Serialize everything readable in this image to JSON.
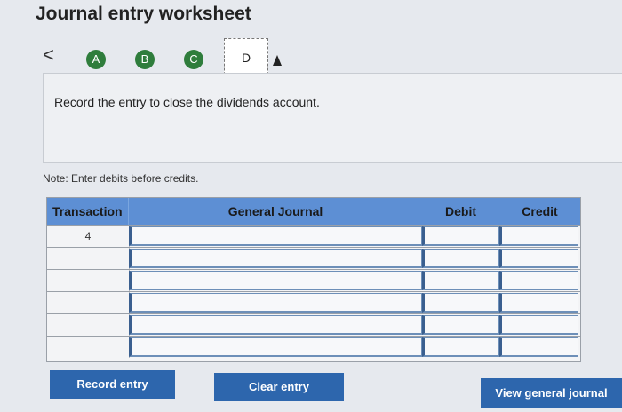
{
  "title": "Journal entry worksheet",
  "nav": {
    "back_symbol": "<",
    "steps": [
      "A",
      "B",
      "C",
      "D"
    ],
    "current_step": "D"
  },
  "instruction": "Record the entry to close the dividends account.",
  "note": "Note: Enter debits before credits.",
  "table": {
    "headers": {
      "transaction": "Transaction",
      "general_journal": "General Journal",
      "debit": "Debit",
      "credit": "Credit"
    },
    "rows": [
      {
        "transaction": "4"
      },
      {
        "transaction": ""
      },
      {
        "transaction": ""
      },
      {
        "transaction": ""
      },
      {
        "transaction": ""
      },
      {
        "transaction": ""
      }
    ]
  },
  "buttons": {
    "record": "Record entry",
    "clear": "Clear entry",
    "view": "View general journal"
  },
  "colors": {
    "step_complete": "#2f7d3c",
    "header": "#5d8fd4",
    "button": "#2d66ad"
  }
}
